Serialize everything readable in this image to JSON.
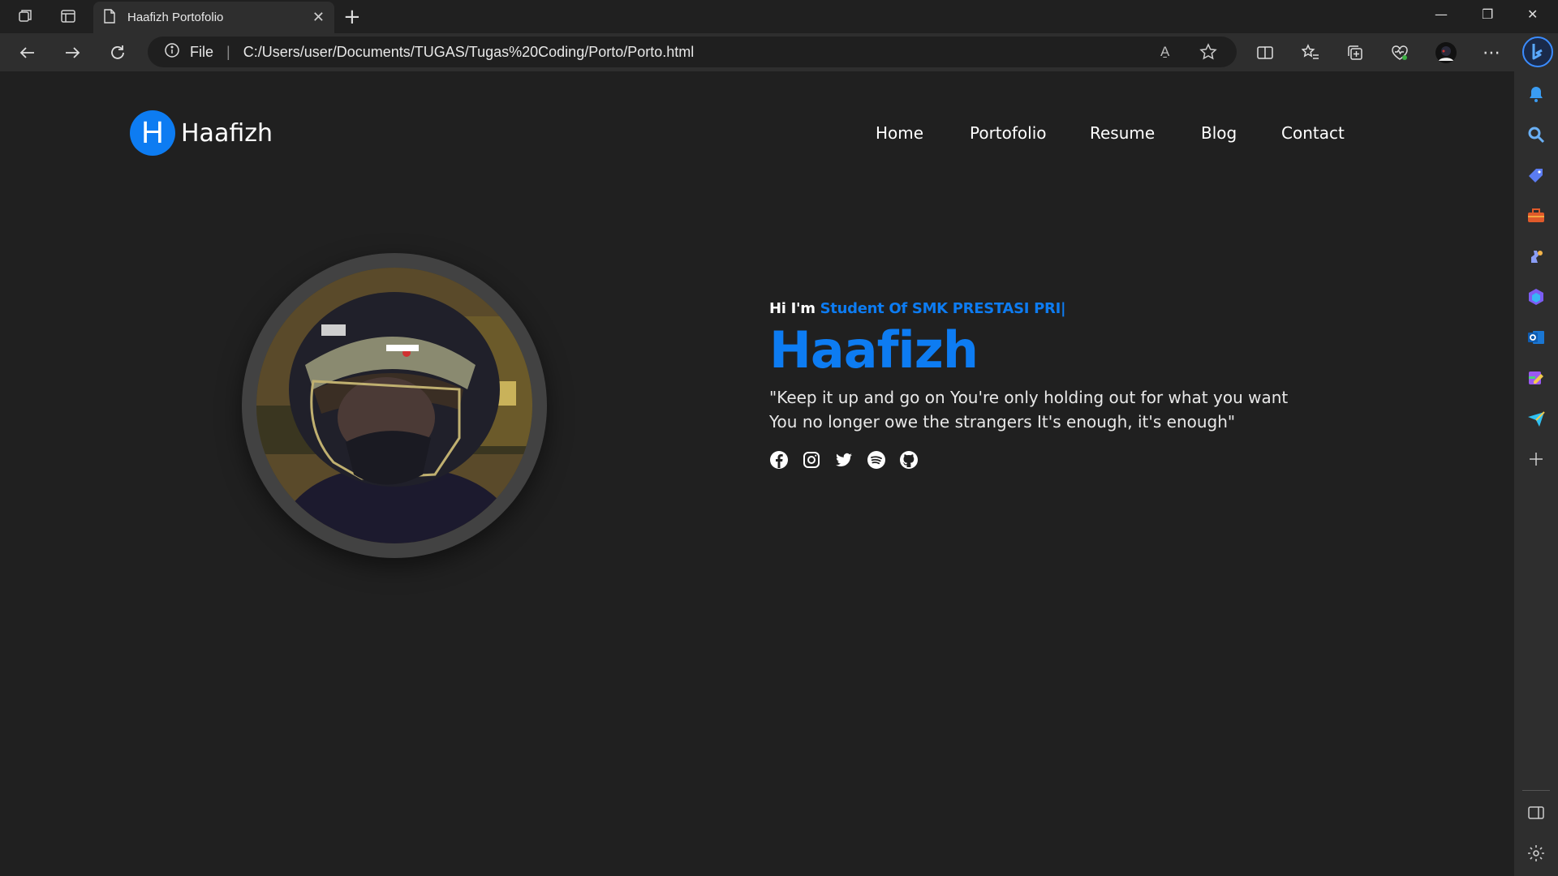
{
  "browser": {
    "tab_title": "Haafizh Portofolio",
    "address_label": "File",
    "url": "C:/Users/user/Documents/TUGAS/Tugas%20Coding/Porto/Porto.html",
    "read_aloud_glyph": "A̱",
    "more_glyph": "⋯"
  },
  "site": {
    "logo_letter": "H",
    "logo_text": "Haafizh",
    "nav": [
      "Home",
      "Portofolio",
      "Resume",
      "Blog",
      "Contact"
    ]
  },
  "hero": {
    "greeting": "Hi I'm ",
    "role": "Student Of SMK PRESTASI PRI",
    "cursor": "|",
    "name": "Haafizh",
    "quote": "\"Keep it up and go on You're only holding out for what you want You no longer owe the strangers It's enough, it's enough\"",
    "socials": [
      "facebook-icon",
      "instagram-icon",
      "twitter-icon",
      "spotify-icon",
      "github-icon"
    ]
  },
  "colors": {
    "accent": "#0d7cf2",
    "page_bg": "#202020",
    "chrome_bg": "#2e2e2e"
  }
}
